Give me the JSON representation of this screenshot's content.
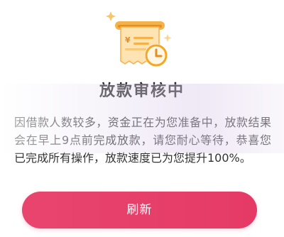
{
  "status": {
    "title": "放款审核中",
    "message": "因借款人数较多，资金正在为您准备中，放款结果会在早上9点前完成放款，请您耐心等待，恭喜您已完成所有操作，放款速度已为您提升100%。"
  },
  "actions": {
    "refresh_label": "刷新"
  },
  "colors": {
    "accent": "#E53A66",
    "illustration_orange": "#F5A623",
    "illustration_light": "#FFE9C7"
  },
  "icons": {
    "illustration": "receipt-printer-clock-icon"
  }
}
